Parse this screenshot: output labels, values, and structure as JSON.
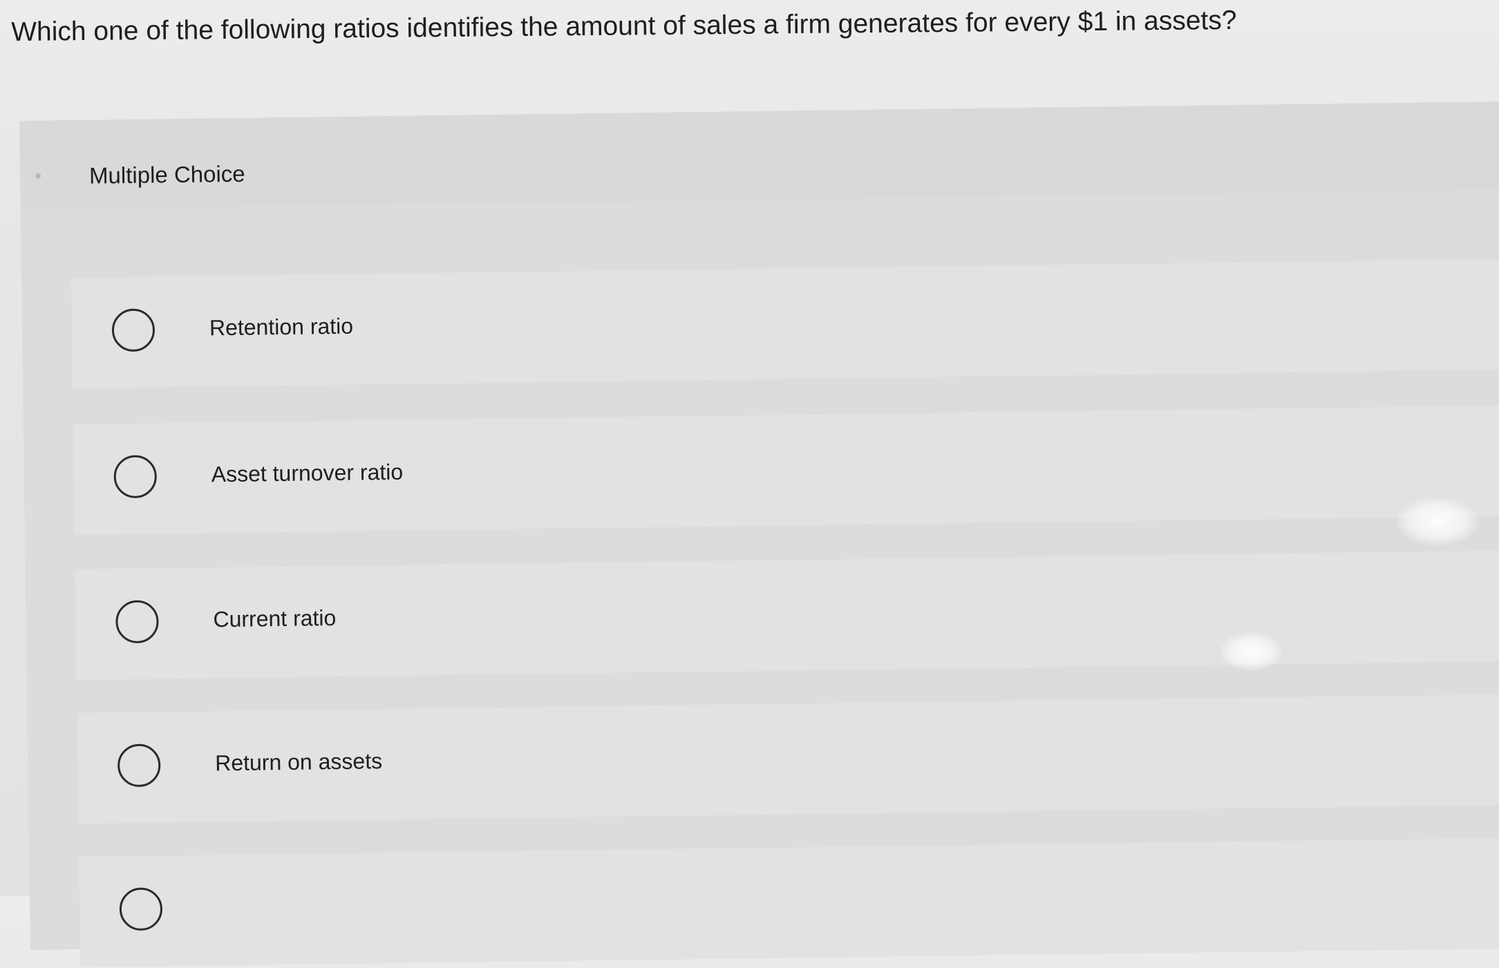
{
  "question": {
    "text": "Which one of the following ratios identifies the amount of sales a firm generates for every $1 in assets?"
  },
  "panel": {
    "title": "Multiple Choice"
  },
  "options": [
    {
      "label": "Retention ratio",
      "selected": false
    },
    {
      "label": "Asset turnover ratio",
      "selected": false
    },
    {
      "label": "Current ratio",
      "selected": false
    },
    {
      "label": "Return on assets",
      "selected": false
    }
  ],
  "colors": {
    "page_background": "#e6e6e6",
    "panel_background": "#dcdcdc",
    "option_background": "#e2e2e2",
    "text": "#1e1e1e",
    "radio_border": "#2a2a2a"
  }
}
